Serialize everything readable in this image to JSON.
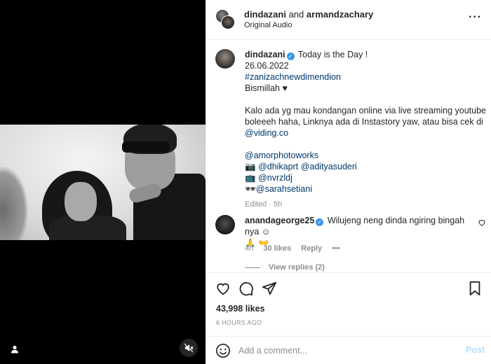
{
  "header": {
    "user1": "dindazani",
    "joiner": "and",
    "user2": "armandzachary",
    "audio": "Original Audio",
    "more_label": "···"
  },
  "caption": {
    "username": "dindazani",
    "line1": "Today is the Day !",
    "line2": "26.06.2022",
    "hashtag": "#zanizachnewdimendion",
    "line4": "Bismillah",
    "para1": "Kalo ada yg mau kondangan online via live streaming youtube boleeeh haha, Linknya ada di Instastory yaw, atau bisa cek di",
    "link": "@viding.co",
    "credit1": "@amorphotoworks",
    "credit2a": "@dhikaprt",
    "credit2b": "@adityasuderi",
    "credit3": "@nvrzldj",
    "credit4": "@sarahsetiani",
    "meta": "Edited · 5h"
  },
  "comment": {
    "username": "anandageorge25",
    "text": "Wilujeng neng dinda ngiring bingah nya",
    "time": "4h",
    "likes": "30 likes",
    "reply": "Reply",
    "more": "•••",
    "view_replies": "View replies (2)"
  },
  "post": {
    "likes": "43,998 likes",
    "time": "6 HOURS AGO"
  },
  "add_comment": {
    "placeholder": "Add a comment...",
    "post_label": "Post"
  },
  "colors": {
    "accent": "#3897f0",
    "link": "#00376b",
    "muted": "#8e8e8e",
    "post_disabled": "#b2dffc"
  },
  "icons": [
    "user-tag-icon",
    "mute-icon",
    "more-icon",
    "verified-icon",
    "heart-icon",
    "comment-icon",
    "share-icon",
    "bookmark-icon",
    "emoji-icon"
  ]
}
